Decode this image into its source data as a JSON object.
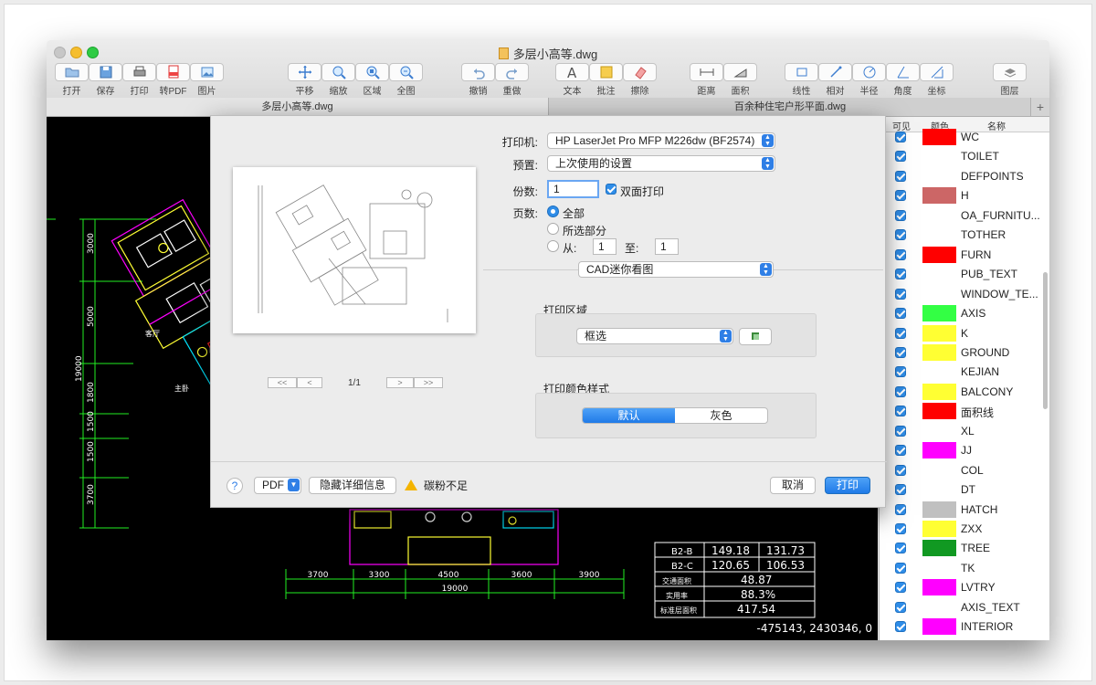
{
  "window": {
    "title": "多层小高等.dwg"
  },
  "toolbar": [
    {
      "label": "打开",
      "icon": "folder-icon",
      "name": "open"
    },
    {
      "label": "保存",
      "icon": "save-icon",
      "name": "save"
    },
    {
      "label": "打印",
      "icon": "printer-icon",
      "name": "print"
    },
    {
      "label": "转PDF",
      "icon": "pdf-icon",
      "name": "to-pdf"
    },
    {
      "label": "图片",
      "icon": "image-icon",
      "name": "image"
    },
    {
      "label": "平移",
      "icon": "pan-icon",
      "name": "pan"
    },
    {
      "label": "缩放",
      "icon": "zoom-icon",
      "name": "zoom"
    },
    {
      "label": "区域",
      "icon": "zoom-area-icon",
      "name": "area"
    },
    {
      "label": "全图",
      "icon": "zoom-all-icon",
      "name": "full-view"
    },
    {
      "label": "撤销",
      "icon": "undo-icon",
      "name": "undo"
    },
    {
      "label": "重做",
      "icon": "redo-icon",
      "name": "redo"
    },
    {
      "label": "文本",
      "icon": "text-icon",
      "name": "text"
    },
    {
      "label": "批注",
      "icon": "note-icon",
      "name": "annotate"
    },
    {
      "label": "擦除",
      "icon": "eraser-icon",
      "name": "erase"
    },
    {
      "label": "距离",
      "icon": "distance-icon",
      "name": "distance"
    },
    {
      "label": "面积",
      "icon": "area-measure-icon",
      "name": "area-measure"
    },
    {
      "label": "线性",
      "icon": "linear-dim-icon",
      "name": "linear"
    },
    {
      "label": "相对",
      "icon": "relative-dim-icon",
      "name": "relative"
    },
    {
      "label": "半径",
      "icon": "radius-icon",
      "name": "radius"
    },
    {
      "label": "角度",
      "icon": "angle-icon",
      "name": "angle"
    },
    {
      "label": "坐标",
      "icon": "coordinate-icon",
      "name": "coordinate"
    },
    {
      "label": "图层",
      "icon": "layers-icon",
      "name": "layers"
    }
  ],
  "tabs": [
    {
      "label": "多层小高等.dwg",
      "active": true
    },
    {
      "label": "百余种住宅户形平面.dwg",
      "active": false
    }
  ],
  "tab_add": "+",
  "status": {
    "coordinates": "-475143, 2430346, 0"
  },
  "cad_text": {
    "vertical_dims": [
      "3000",
      "5000",
      "1800",
      "1500",
      "1500",
      "3700"
    ],
    "total_vertical": "19000",
    "horizontal_dims": [
      "3700",
      "3300",
      "4500",
      "3600",
      "3900"
    ],
    "total_horizontal": "19000",
    "table_rows": [
      [
        "B2-B",
        "149.18",
        "131.73"
      ],
      [
        "B2-C",
        "120.65",
        "106.53"
      ],
      [
        "交通面积",
        "48.87",
        ""
      ],
      [
        "实用率",
        "88.3%",
        ""
      ],
      [
        "标准层面积",
        "417.54",
        ""
      ]
    ]
  },
  "layers_panel": {
    "headers": {
      "visible": "可见",
      "color": "颜色",
      "name": "名称"
    },
    "items": [
      {
        "name": "WC",
        "color": "#ff0000"
      },
      {
        "name": "TOILET",
        "color": ""
      },
      {
        "name": "DEFPOINTS",
        "color": ""
      },
      {
        "name": "H",
        "color": "#cc6666"
      },
      {
        "name": "OA_FURNITU...",
        "color": ""
      },
      {
        "name": "TOTHER",
        "color": ""
      },
      {
        "name": "FURN",
        "color": "#ff0000"
      },
      {
        "name": "PUB_TEXT",
        "color": ""
      },
      {
        "name": "WINDOW_TE...",
        "color": ""
      },
      {
        "name": "AXIS",
        "color": "#33ff44"
      },
      {
        "name": "K",
        "color": "#ffff33"
      },
      {
        "name": "GROUND",
        "color": "#ffff33"
      },
      {
        "name": "KEJIAN",
        "color": ""
      },
      {
        "name": "BALCONY",
        "color": "#ffff33"
      },
      {
        "name": "面积线",
        "color": "#ff0000"
      },
      {
        "name": "XL",
        "color": ""
      },
      {
        "name": "JJ",
        "color": "#ff00ff"
      },
      {
        "name": "COL",
        "color": ""
      },
      {
        "name": "DT",
        "color": ""
      },
      {
        "name": "HATCH",
        "color": "#c0c0c0"
      },
      {
        "name": "ZXX",
        "color": "#ffff33"
      },
      {
        "name": "TREE",
        "color": "#119922"
      },
      {
        "name": "TK",
        "color": ""
      },
      {
        "name": "LVTRY",
        "color": "#ff00ff"
      },
      {
        "name": "AXIS_TEXT",
        "color": ""
      },
      {
        "name": "INTERIOR",
        "color": "#ff00ff"
      }
    ]
  },
  "print_dialog": {
    "printer_label": "打印机:",
    "printer_value": "HP LaserJet Pro MFP M226dw (BF2574)",
    "preset_label": "预置:",
    "preset_value": "上次使用的设置",
    "copies_label": "份数:",
    "copies_value": "1",
    "duplex_label": "双面打印",
    "pages_label": "页数:",
    "pages_all": "全部",
    "pages_selection": "所选部分",
    "pages_from": "从:",
    "pages_from_value": "1",
    "pages_to": "至:",
    "pages_to_value": "1",
    "section_popup": "CAD迷你看图",
    "print_area_title": "打印区域",
    "print_area_value": "框选",
    "color_style_title": "打印颜色样式",
    "color_default": "默认",
    "color_gray": "灰色",
    "page_indicator": "1/1",
    "pager_first": "<<",
    "pager_prev": "<",
    "pager_next": ">",
    "pager_last": ">>",
    "help": "?",
    "pdf_button": "PDF",
    "hide_details": "隐藏详细信息",
    "warning_text": "碳粉不足",
    "cancel": "取消",
    "print": "打印"
  }
}
